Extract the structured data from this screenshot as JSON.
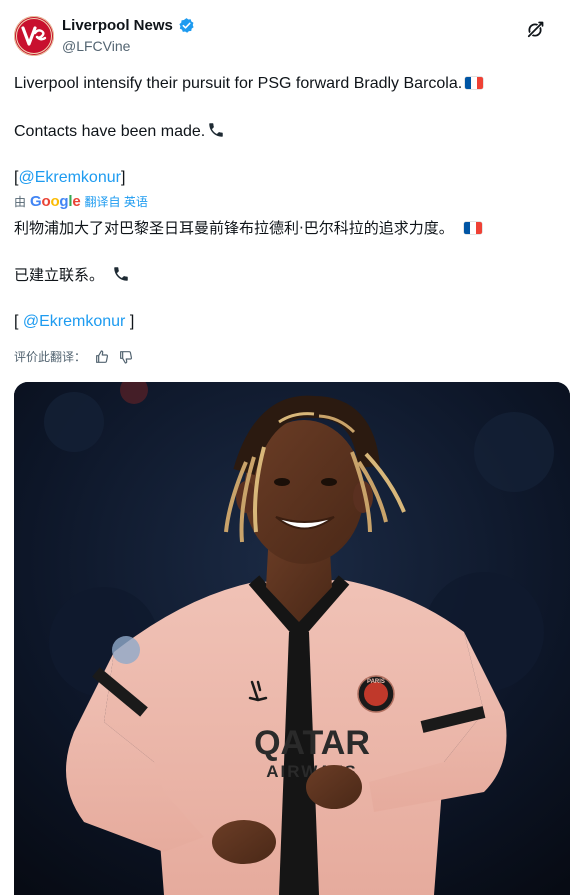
{
  "tweet": {
    "author": {
      "display_name": "Liverpool News",
      "handle": "@LFCVine",
      "verified": true,
      "avatar_icon": "vine-logo-icon"
    },
    "grok_icon": "grok-icon",
    "original": {
      "line1": "Liverpool intensify their pursuit for PSG forward Bradly Barcola.",
      "line2": "Contacts have been made.",
      "mention_open": "[",
      "mention": "@Ekremkonur",
      "mention_close": "]"
    },
    "translation_bar": {
      "prefix": "由",
      "provider": "Google",
      "suffix": "翻译自 英语"
    },
    "translated": {
      "line1": "利物浦加大了对巴黎圣日耳曼前锋布拉德利·巴尔科拉的追求力度。",
      "line2": "已建立联系。",
      "mention_open": "[ ",
      "mention": "@Ekremkonur",
      "mention_close": " ]"
    },
    "rate_translation": "评价此翻译：",
    "media": {
      "jersey_sponsor_line1": "QATAR",
      "jersey_sponsor_line2": "AIRWAYS",
      "crest_text": "PARIS"
    },
    "colors": {
      "link": "#1d9bf0",
      "verified": "#1d9bf0",
      "secondary_text": "#536471",
      "avatar_bg": "#c8102e"
    }
  }
}
